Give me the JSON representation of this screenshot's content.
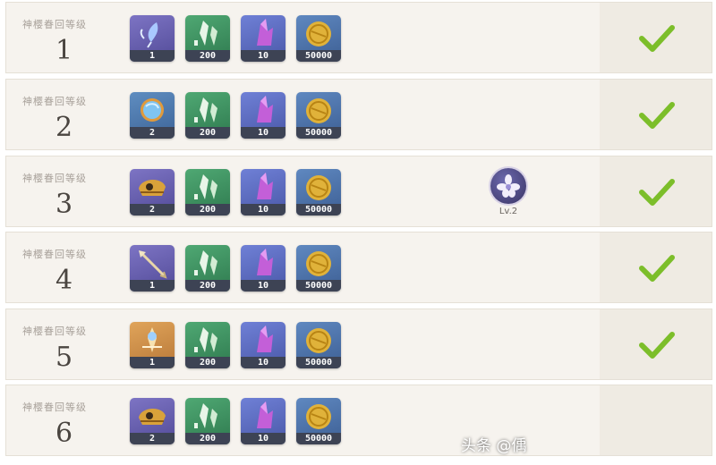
{
  "level_label": "神樱眷回等级",
  "rows": [
    {
      "level": "1",
      "first_item": {
        "icon": "blue-feather-icon",
        "qty": "1",
        "bg": "purple"
      },
      "completed": true
    },
    {
      "level": "2",
      "first_item": {
        "icon": "blue-orb-icon",
        "qty": "2",
        "bg": "blue"
      },
      "completed": true
    },
    {
      "level": "3",
      "first_item": {
        "icon": "golden-helmet-icon",
        "qty": "2",
        "bg": "purple"
      },
      "completed": true
    },
    {
      "level": "4",
      "first_item": {
        "icon": "arrow-icon",
        "qty": "1",
        "bg": "purple"
      },
      "completed": true
    },
    {
      "level": "5",
      "first_item": {
        "icon": "golden-charm-icon",
        "qty": "1",
        "bg": "orange"
      },
      "completed": true
    },
    {
      "level": "6",
      "first_item": {
        "icon": "golden-helmet-icon",
        "qty": "2",
        "bg": "purple"
      },
      "completed": false
    }
  ],
  "common_items": [
    {
      "icon": "green-crystal-icon",
      "qty": "200",
      "bg": "#3d8a5c"
    },
    {
      "icon": "purple-crystal-icon",
      "qty": "10",
      "bg": "#5f6fbf"
    },
    {
      "icon": "mora-coin-icon",
      "qty": "50000",
      "bg": "#4b6fa6"
    }
  ],
  "special_reward": {
    "icon": "purple-flower-icon",
    "label": "Lv.2",
    "row": "3"
  },
  "watermark": "头条 @偊",
  "colors": {
    "check": "#7cbe2a",
    "number": "#4a4540",
    "label": "#a8a19a"
  }
}
